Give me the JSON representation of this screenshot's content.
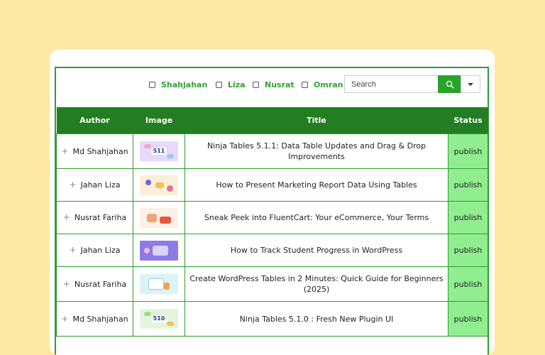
{
  "filters": [
    {
      "label": "Shahjahan",
      "checked": false
    },
    {
      "label": "Liza",
      "checked": false
    },
    {
      "label": "Nusrat",
      "checked": false
    },
    {
      "label": "Omran",
      "checked": false
    }
  ],
  "search": {
    "placeholder": "Search",
    "value": ""
  },
  "table": {
    "headers": [
      "Author",
      "Image",
      "Title",
      "Status"
    ],
    "rows": [
      {
        "author": "Md Shahjahan",
        "thumb_text": "511",
        "title": "Ninja Tables 5.1.1: Data Table Updates and Drag & Drop Improvements",
        "status": "publish"
      },
      {
        "author": "Jahan Liza",
        "thumb_text": "",
        "title": "How to Present Marketing Report Data Using Tables",
        "status": "publish"
      },
      {
        "author": "Nusrat Fariha",
        "thumb_text": "",
        "title": "Sneak Peek into FluentCart: Your eCommerce, Your Terms",
        "status": "publish"
      },
      {
        "author": "Jahan Liza",
        "thumb_text": "",
        "title": "How to Track Student Progress in WordPress",
        "status": "publish"
      },
      {
        "author": "Nusrat Fariha",
        "thumb_text": "",
        "title": "Create WordPress Tables in 2 Minutes: Quick Guide for Beginners (2025)",
        "status": "publish"
      },
      {
        "author": "Md Shahjahan",
        "thumb_text": "510",
        "title": "Ninja Tables 5.1.0 : Fresh New Plugin UI",
        "status": "publish"
      }
    ]
  },
  "colors": {
    "background": "#fde9a4",
    "accent": "#28a428",
    "header": "#237e23",
    "status_bg": "#90ee90"
  }
}
